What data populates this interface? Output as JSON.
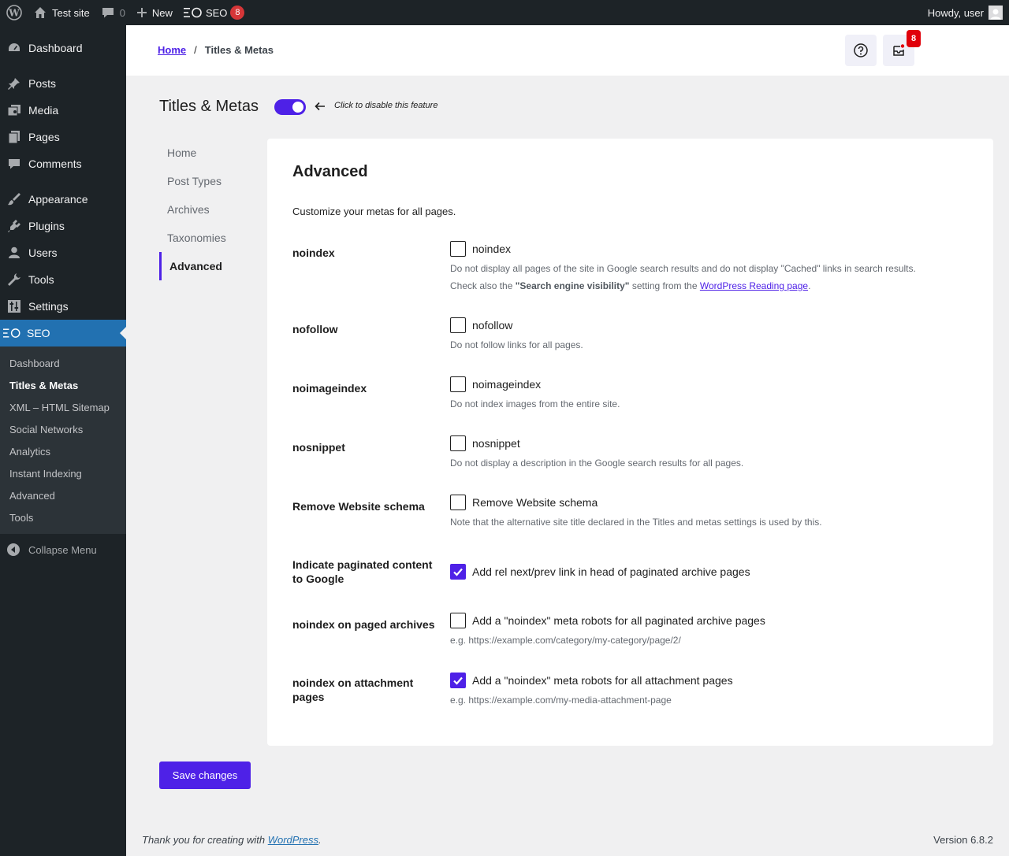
{
  "adminbar": {
    "site_name": "Test site",
    "comments_count": "0",
    "new_label": "New",
    "seo_label": "SEO",
    "seo_badge": "8",
    "howdy": "Howdy, user"
  },
  "sidebar": {
    "items": [
      {
        "label": "Dashboard",
        "icon": "dashboard-icon"
      },
      {
        "label": "Posts",
        "icon": "pin-icon"
      },
      {
        "label": "Media",
        "icon": "media-icon"
      },
      {
        "label": "Pages",
        "icon": "pages-icon"
      },
      {
        "label": "Comments",
        "icon": "comment-icon"
      },
      {
        "label": "Appearance",
        "icon": "brush-icon"
      },
      {
        "label": "Plugins",
        "icon": "plugin-icon"
      },
      {
        "label": "Users",
        "icon": "user-icon"
      },
      {
        "label": "Tools",
        "icon": "wrench-icon"
      },
      {
        "label": "Settings",
        "icon": "settings-icon"
      },
      {
        "label": "SEO",
        "icon": "seo-icon"
      }
    ],
    "submenu": [
      "Dashboard",
      "Titles & Metas",
      "XML – HTML Sitemap",
      "Social Networks",
      "Analytics",
      "Instant Indexing",
      "Advanced",
      "Tools"
    ],
    "collapse": "Collapse Menu"
  },
  "header": {
    "breadcrumb_home": "Home",
    "breadcrumb_sep": "/",
    "breadcrumb_current": "Titles & Metas",
    "notif_badge": "8"
  },
  "page": {
    "title": "Titles & Metas",
    "toggle_hint": "Click to disable this feature",
    "tabs": [
      "Home",
      "Post Types",
      "Archives",
      "Taxonomies",
      "Advanced"
    ]
  },
  "card": {
    "title": "Advanced",
    "description": "Customize your metas for all pages.",
    "rows": [
      {
        "label": "noindex",
        "checkbox": "noindex",
        "checked": false,
        "desc": "Do not display all pages of the site in Google search results and do not display \"Cached\" links in search results.",
        "desc2_pre": "Check also the ",
        "desc2_bold": "\"Search engine visibility\"",
        "desc2_mid": " setting from the ",
        "desc2_link": "WordPress Reading page",
        "desc2_post": "."
      },
      {
        "label": "nofollow",
        "checkbox": "nofollow",
        "checked": false,
        "desc": "Do not follow links for all pages."
      },
      {
        "label": "noimageindex",
        "checkbox": "noimageindex",
        "checked": false,
        "desc": "Do not index images from the entire site."
      },
      {
        "label": "nosnippet",
        "checkbox": "nosnippet",
        "checked": false,
        "desc": "Do not display a description in the Google search results for all pages."
      },
      {
        "label": "Remove Website schema",
        "checkbox": "Remove Website schema",
        "checked": false,
        "desc": "Note that the alternative site title declared in the Titles and metas settings is used by this."
      },
      {
        "label": "Indicate paginated content to Google",
        "checkbox": "Add rel next/prev link in head of paginated archive pages",
        "checked": true
      },
      {
        "label": "noindex on paged archives",
        "checkbox": "Add a \"noindex\" meta robots for all paginated archive pages",
        "checked": false,
        "desc": "e.g. https://example.com/category/my-category/page/2/"
      },
      {
        "label": "noindex on attachment pages",
        "checkbox": "Add a \"noindex\" meta robots for all attachment pages",
        "checked": true,
        "desc": "e.g. https://example.com/my-media-attachment-page"
      }
    ]
  },
  "save_label": "Save changes",
  "footer": {
    "thanks_pre": "Thank you for creating with ",
    "thanks_link": "WordPress",
    "thanks_post": ".",
    "version": "Version 6.8.2"
  },
  "colors": {
    "accent": "#4e21e7",
    "admin_dark": "#1d2327",
    "wp_blue": "#2271b1",
    "badge_red": "#d63638"
  }
}
